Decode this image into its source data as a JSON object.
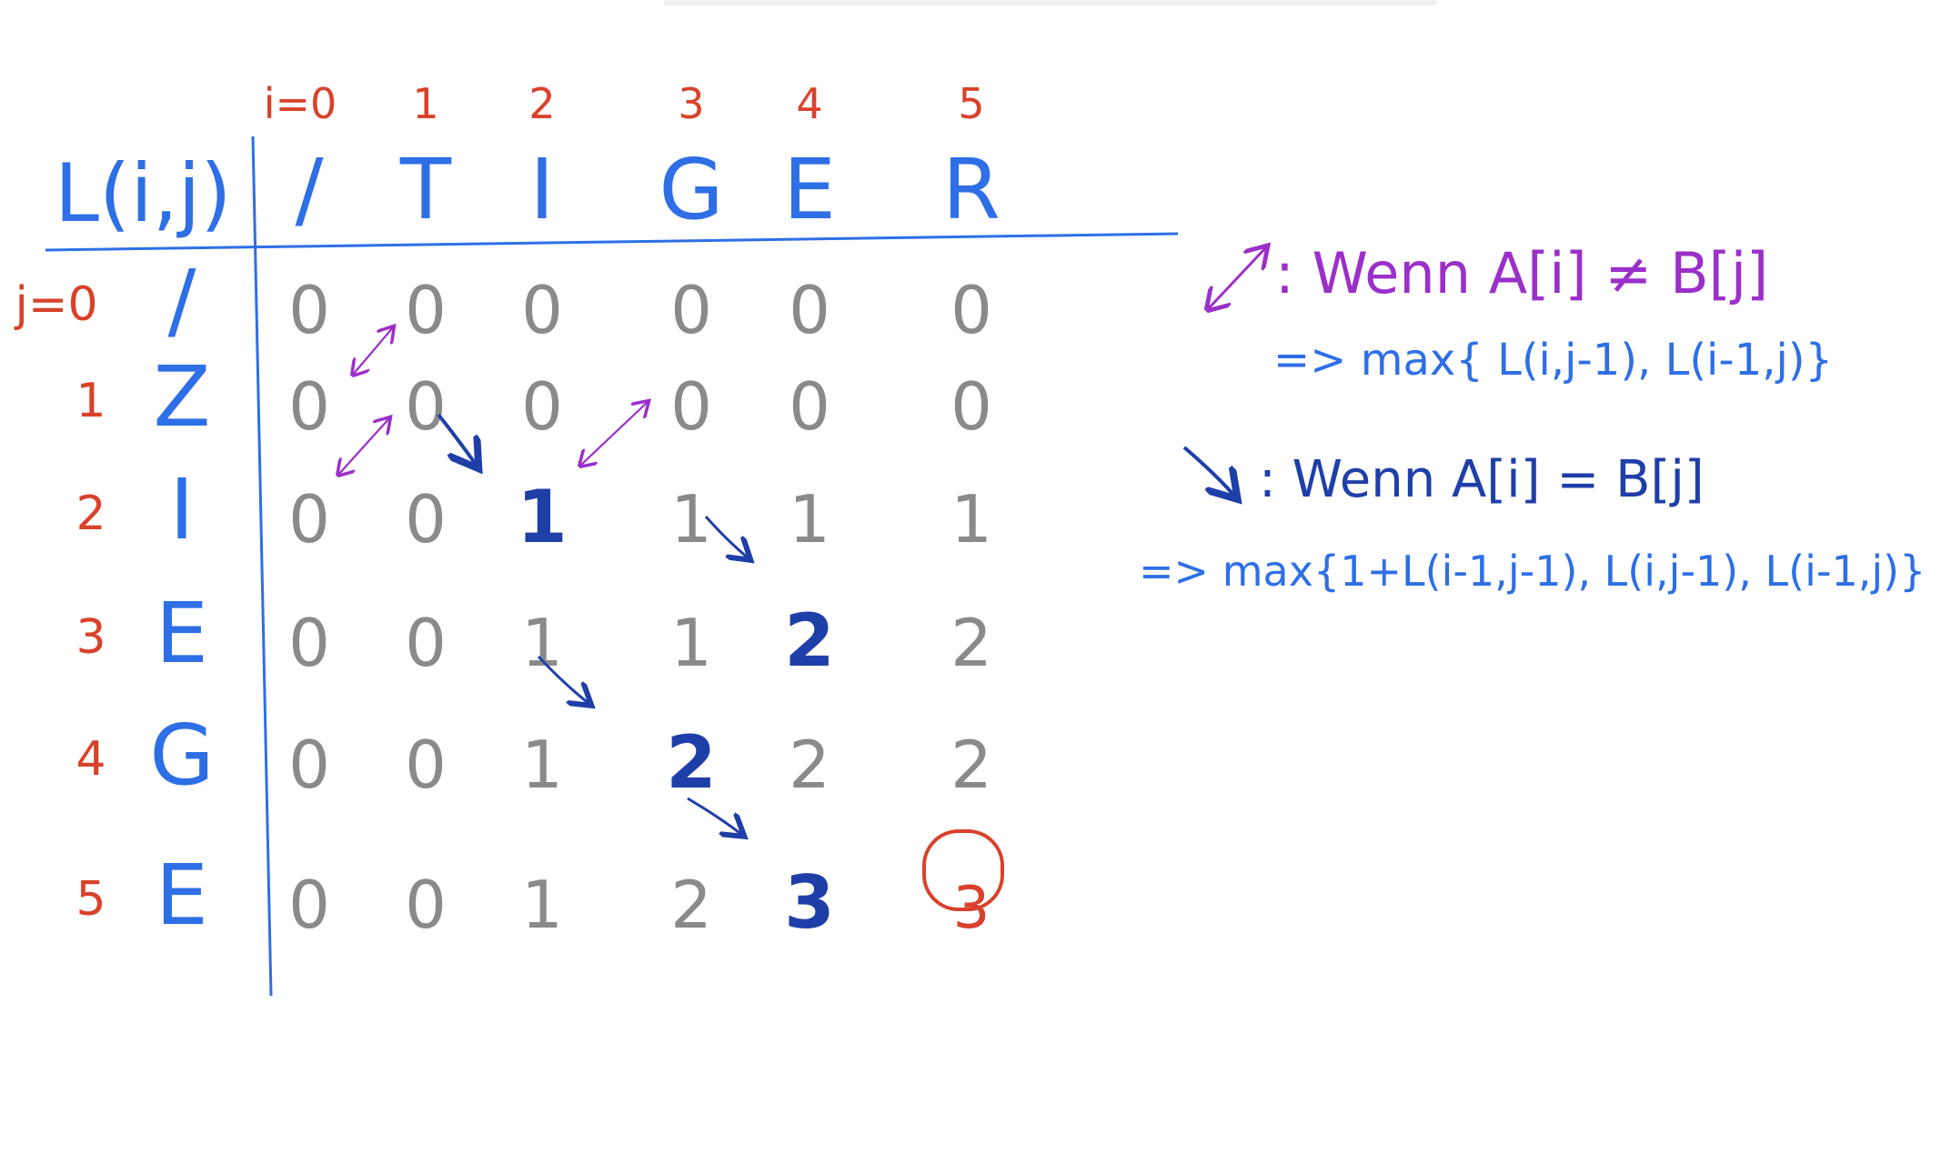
{
  "table": {
    "corner_label": "L(i,j)",
    "col_header_labels": [
      "i=0",
      "1",
      "2",
      "3",
      "4",
      "5"
    ],
    "col_letters": [
      "/",
      "T",
      "I",
      "G",
      "E",
      "R"
    ],
    "row_header_labels": [
      "j=0",
      "1",
      "2",
      "3",
      "4",
      "5"
    ],
    "row_letters": [
      "/",
      "Z",
      "I",
      "E",
      "G",
      "E"
    ],
    "cells": [
      [
        "0",
        "0",
        "0",
        "0",
        "0",
        "0"
      ],
      [
        "0",
        "0",
        "0",
        "0",
        "0",
        "0"
      ],
      [
        "0",
        "0",
        "1",
        "1",
        "1",
        "1"
      ],
      [
        "0",
        "0",
        "1",
        "1",
        "2",
        "2"
      ],
      [
        "0",
        "0",
        "1",
        "2",
        "2",
        "2"
      ],
      [
        "0",
        "0",
        "1",
        "2",
        "3",
        "3"
      ]
    ],
    "highlighted_cells": [
      [
        2,
        2
      ],
      [
        3,
        4
      ],
      [
        4,
        3
      ],
      [
        5,
        4
      ]
    ],
    "result_cell": [
      5,
      5
    ]
  },
  "legend": {
    "mismatch_text": ": Wenn A[i] ≠ B[j]",
    "mismatch_formula": "=> max{ L(i,j-1), L(i-1,j)}",
    "match_text": ": Wenn A[i] = B[j]",
    "match_formula": "=> max{1+L(i-1,j-1), L(i,j-1), L(i-1,j)}"
  },
  "colors": {
    "red": "#d9412b",
    "blue": "#2e6fe6",
    "dark_blue": "#1f3fa8",
    "gray": "#8a8a8a",
    "purple": "#9b2fc9"
  }
}
